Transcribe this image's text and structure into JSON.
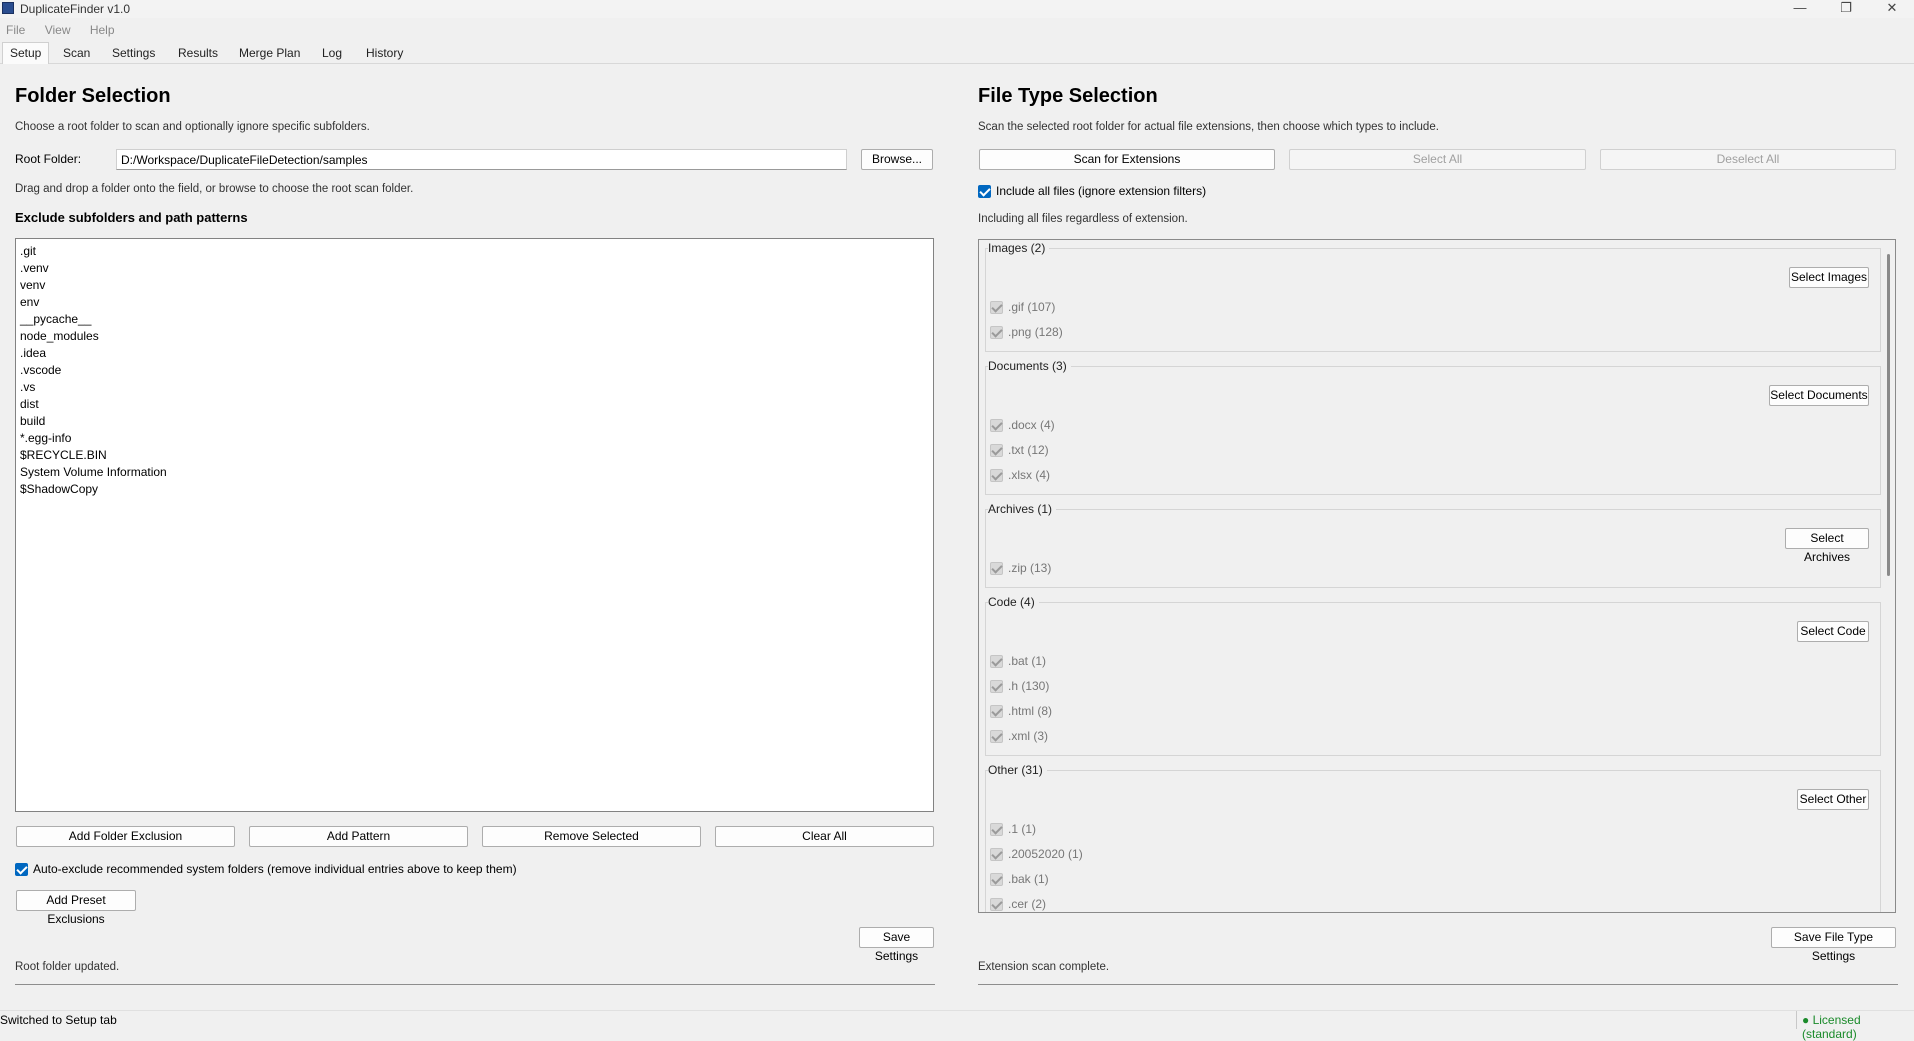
{
  "window": {
    "title": "DuplicateFinder v1.0",
    "controls": [
      "—",
      "❐",
      "✕"
    ]
  },
  "menu": [
    "File",
    "View",
    "Help"
  ],
  "tabs": [
    "Setup",
    "Scan",
    "Settings",
    "Results",
    "Merge Plan",
    "Log",
    "History"
  ],
  "folder": {
    "heading": "Folder Selection",
    "description": "Choose a root folder to scan and optionally ignore specific subfolders.",
    "root_label": "Root Folder:",
    "root_value": "D:/Workspace/DuplicateFileDetection/samples",
    "browse_label": "Browse...",
    "hint": "Drag and drop a folder onto the field, or browse to choose the root scan folder.",
    "exclude_heading": "Exclude subfolders and path patterns",
    "exclusions": [
      ".git",
      ".venv",
      "venv",
      "env",
      "__pycache__",
      "node_modules",
      ".idea",
      ".vscode",
      ".vs",
      "dist",
      "build",
      "*.egg-info",
      "$RECYCLE.BIN",
      "System Volume Information",
      "$ShadowCopy"
    ],
    "buttons": {
      "add_folder": "Add Folder Exclusion",
      "add_pattern": "Add Pattern",
      "remove": "Remove Selected",
      "clear": "Clear All"
    },
    "auto_exclude_label": "Auto-exclude recommended system folders (remove individual entries above to keep them)",
    "auto_exclude_checked": true,
    "preset_label": "Add Preset Exclusions",
    "save_label": "Save Settings",
    "status": "Root folder updated."
  },
  "filetypes": {
    "heading": "File Type Selection",
    "description": "Scan the selected root folder for actual file extensions, then choose which types to include.",
    "scan_label": "Scan for Extensions",
    "select_all_label": "Select All",
    "deselect_all_label": "Deselect All",
    "include_all_label": "Include all files (ignore extension filters)",
    "include_all_checked": true,
    "include_hint": "Including all files regardless of extension.",
    "groups": [
      {
        "title": "Images (2)",
        "button": "Select Images",
        "items": [
          ".gif (107)",
          ".png (128)"
        ]
      },
      {
        "title": "Documents (3)",
        "button": "Select Documents",
        "items": [
          ".docx (4)",
          ".txt (12)",
          ".xlsx (4)"
        ]
      },
      {
        "title": "Archives (1)",
        "button": "Select Archives",
        "items": [
          ".zip (13)"
        ]
      },
      {
        "title": "Code (4)",
        "button": "Select Code",
        "items": [
          ".bat (1)",
          ".h (130)",
          ".html (8)",
          ".xml (3)"
        ]
      },
      {
        "title": "Other (31)",
        "button": "Select Other",
        "items": [
          ".1 (1)",
          ".20052020 (1)",
          ".bak (1)",
          ".cer (2)"
        ]
      }
    ],
    "save_label": "Save File Type Settings",
    "status": "Extension scan complete."
  },
  "statusbar": {
    "message": "Switched to Setup tab",
    "license": "● Licensed (standard)"
  }
}
